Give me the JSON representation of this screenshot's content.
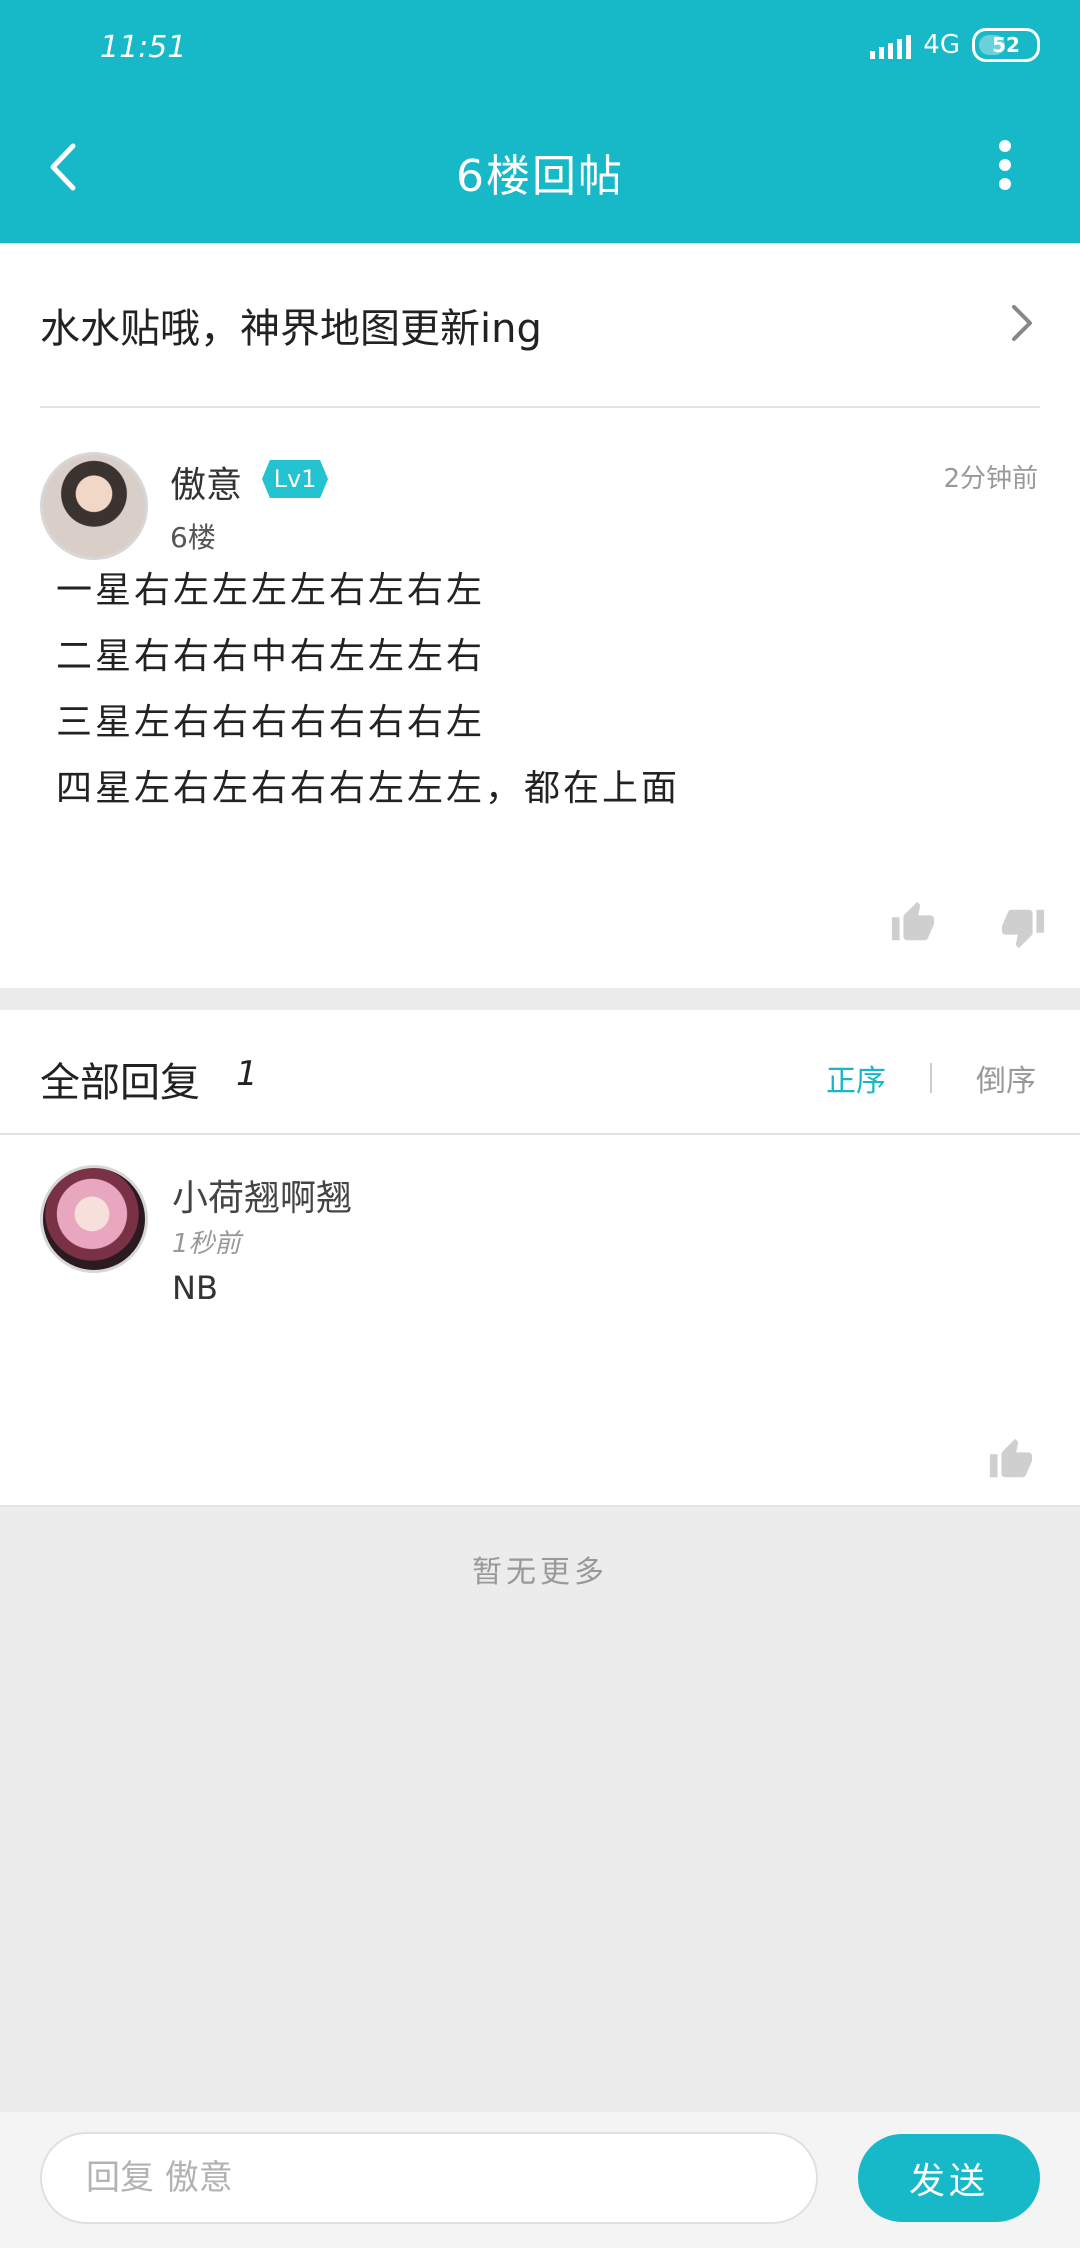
{
  "status_bar": {
    "time": "11:51",
    "network": "4G",
    "battery": "52"
  },
  "header": {
    "title": "6楼回帖"
  },
  "thread": {
    "title": "水水贴哦，神界地图更新ing"
  },
  "post": {
    "username": "傲意",
    "level": "Lv1",
    "floor": "6楼",
    "time": "2分钟前",
    "lines": [
      "一星右左左左左右左右左",
      "二星右右右中右左左左右",
      "三星左右右右右右右右左",
      "四星左右左右右右左左左，都在上面"
    ]
  },
  "replies": {
    "label": "全部回复",
    "count": "1",
    "sort_asc": "正序",
    "sort_desc": "倒序",
    "items": [
      {
        "username": "小荷翘啊翘",
        "time": "1秒前",
        "text": "NB"
      }
    ]
  },
  "footer": {
    "no_more": "暂无更多"
  },
  "reply_bar": {
    "placeholder": "回复 傲意",
    "send_label": "发送"
  },
  "colors": {
    "accent": "#17b8c7",
    "background": "#ececec"
  },
  "icons": [
    "back-arrow-icon",
    "more-vert-icon",
    "chevron-right-icon",
    "thumb-up-icon",
    "thumb-down-icon",
    "signal-icon",
    "battery-icon"
  ]
}
